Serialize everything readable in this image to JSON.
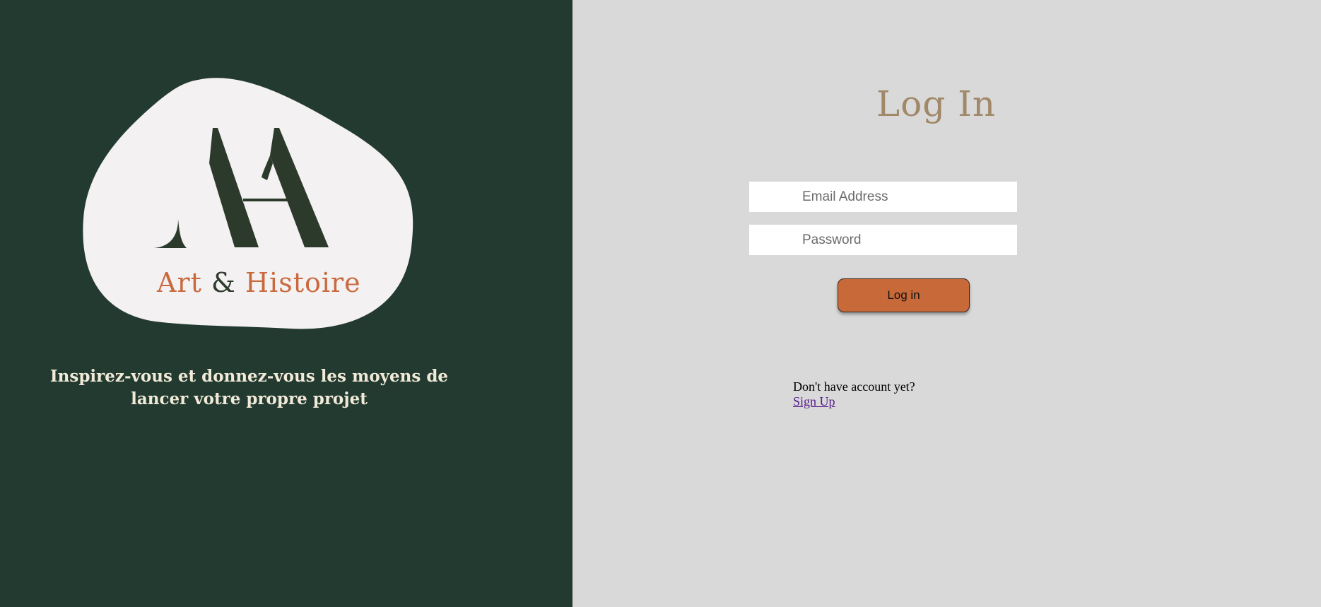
{
  "brand": {
    "monogram": "AH",
    "name_part1": "Art",
    "name_part2": "&",
    "name_part3": "Histoire",
    "tagline": "Inspirez-vous et donnez-vous les moyens de lancer votre propre projet"
  },
  "login": {
    "title": "Log In",
    "email_placeholder": "Email Address",
    "password_placeholder": "Password",
    "submit_label": "Log in",
    "signup_prompt": "Don't have account yet?",
    "signup_link": "Sign Up"
  },
  "colors": {
    "left_panel_bg": "#233a30",
    "right_panel_bg": "#d9d9d9",
    "blob_fill": "#f3f1f2",
    "monogram": "#2c3a2b",
    "brand_accent": "#c96a3e",
    "title": "#a08868",
    "button": "#c8693a",
    "tagline": "#f1ead9",
    "link": "#551a8b"
  }
}
